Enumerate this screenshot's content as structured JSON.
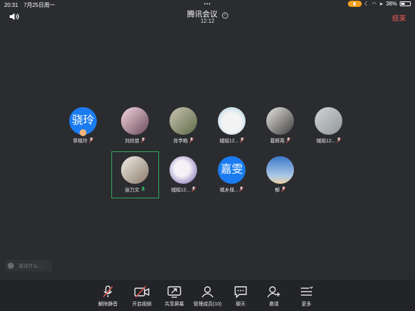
{
  "status_bar": {
    "time": "20:31",
    "date": "7月25日周一",
    "battery": "38%",
    "battery_fraction": 0.38
  },
  "header": {
    "title": "腾讯会议",
    "timer": "12:12",
    "end_label": "结束"
  },
  "participants": [
    {
      "name": "章晓玲",
      "avatar_text": "骁玲",
      "avatar_type": "text",
      "mic": "muted",
      "badge": true
    },
    {
      "name": "刘欣苗",
      "avatar_type": "photo",
      "mic": "muted"
    },
    {
      "name": "肖学皓",
      "avatar_type": "photo",
      "mic": "muted"
    },
    {
      "name": "城规12...",
      "avatar_type": "photo",
      "mic": "muted"
    },
    {
      "name": "葛辉燕",
      "avatar_type": "photo",
      "mic": "muted"
    },
    {
      "name": "城规12...",
      "avatar_type": "photo",
      "mic": "muted"
    },
    {
      "name": "张力文",
      "avatar_type": "photo",
      "mic": "active",
      "speaking": true
    },
    {
      "name": "城规12...",
      "avatar_type": "photo",
      "mic": "muted"
    },
    {
      "name": "城乡规...",
      "avatar_text": "嘉雯",
      "avatar_type": "text",
      "mic": "muted"
    },
    {
      "name": "郁",
      "avatar_type": "photo",
      "mic": "muted"
    }
  ],
  "chat": {
    "placeholder": "说点什么..."
  },
  "toolbar": [
    {
      "label": "解除静音",
      "icon": "mic-off-icon"
    },
    {
      "label": "开启视频",
      "icon": "video-off-icon"
    },
    {
      "label": "共享屏幕",
      "icon": "share-screen-icon"
    },
    {
      "label": "管理成员(10)",
      "icon": "members-icon"
    },
    {
      "label": "聊天",
      "icon": "chat-icon"
    },
    {
      "label": "邀请",
      "icon": "invite-icon"
    },
    {
      "label": "更多",
      "icon": "more-icon"
    }
  ],
  "colors": {
    "accent": "#1a7cf0",
    "end": "#f25c5c",
    "speaking": "#2fae5f",
    "muted": "#e05555",
    "background": "#2b2c2f"
  }
}
